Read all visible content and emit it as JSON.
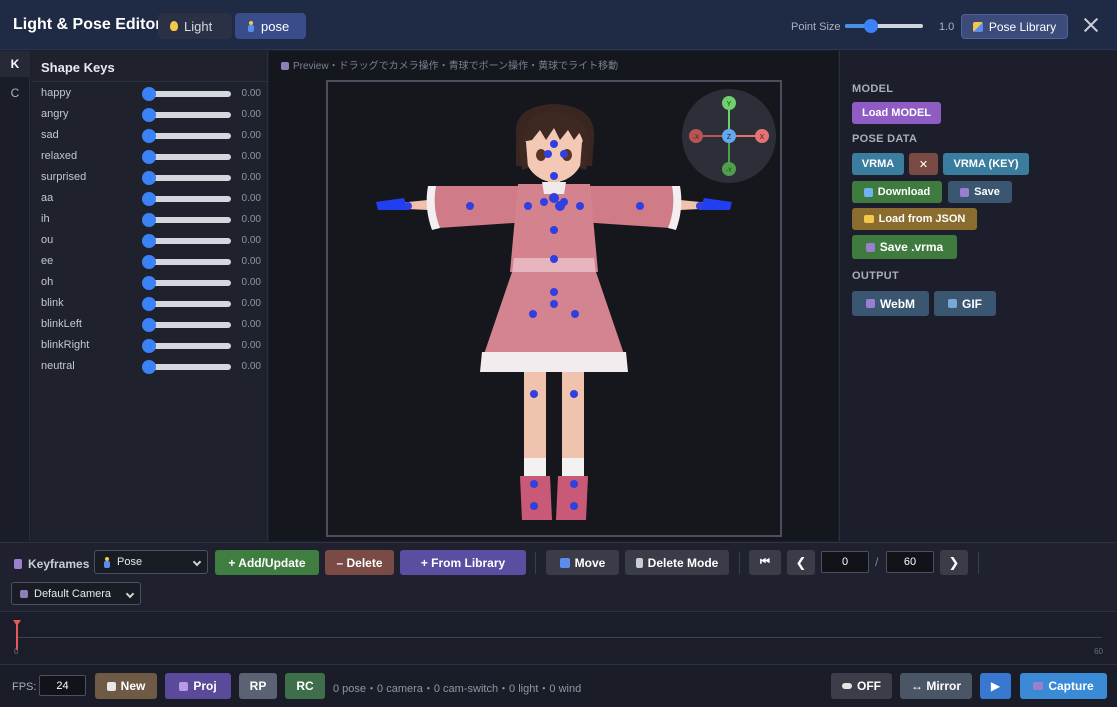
{
  "header": {
    "title": "Light & Pose Editor",
    "tabs": [
      {
        "label": "Light",
        "icon": "lightbulb-icon"
      },
      {
        "label": "pose",
        "icon": "figure-icon"
      }
    ],
    "point_size_label": "Point Size",
    "point_size_value": "1.0",
    "point_size_fraction": 0.33,
    "pose_library_label": "Pose Library"
  },
  "side_tabs": [
    "K",
    "C"
  ],
  "shape_keys": {
    "title": "Shape Keys",
    "items": [
      {
        "label": "happy",
        "value": "0.00"
      },
      {
        "label": "angry",
        "value": "0.00"
      },
      {
        "label": "sad",
        "value": "0.00"
      },
      {
        "label": "relaxed",
        "value": "0.00"
      },
      {
        "label": "surprised",
        "value": "0.00"
      },
      {
        "label": "aa",
        "value": "0.00"
      },
      {
        "label": "ih",
        "value": "0.00"
      },
      {
        "label": "ou",
        "value": "0.00"
      },
      {
        "label": "ee",
        "value": "0.00"
      },
      {
        "label": "oh",
        "value": "0.00"
      },
      {
        "label": "blink",
        "value": "0.00"
      },
      {
        "label": "blinkLeft",
        "value": "0.00"
      },
      {
        "label": "blinkRight",
        "value": "0.00"
      },
      {
        "label": "neutral",
        "value": "0.00"
      }
    ]
  },
  "preview": {
    "hint": "Preview・ドラッグでカメラ操作・青球でボーン操作・黄球でライト移動",
    "gizmo": {
      "x": "X",
      "neg_x": "-X",
      "y": "Y",
      "neg_y": "-Y",
      "z": "Z"
    }
  },
  "right_panel": {
    "model_heading": "MODEL",
    "load_model": "Load MODEL",
    "pose_heading": "POSE DATA",
    "vrma": "VRMA",
    "remove": "✕",
    "vrma_key": "VRMA (KEY)",
    "download": "Download",
    "save": "Save",
    "load_json": "Load from JSON",
    "save_vrma": "Save .vrma",
    "output_heading": "OUTPUT",
    "webm": "WebM",
    "gif": "GIF"
  },
  "keyframes": {
    "label": "Keyframes",
    "type_select": "Pose",
    "add_update": "+ Add/Update",
    "delete": "– Delete",
    "from_library": "+ From Library",
    "move": "Move",
    "delete_mode": "Delete Mode",
    "frame_current": "0",
    "frame_separator": "/",
    "frame_total": "60",
    "camera_select": "Default Camera"
  },
  "timeline": {
    "start": "0",
    "end": "60"
  },
  "footer": {
    "fps_label": "FPS:",
    "fps_value": "24",
    "new": "New",
    "proj": "Proj",
    "rp": "RP",
    "rc": "RC",
    "status": "0 pose・0 camera・0 cam-switch・0 light・0 wind",
    "off": "OFF",
    "mirror": "↔ Mirror",
    "play": "▶",
    "capture": "Capture"
  },
  "colors": {
    "accent": "#3b82f6",
    "joint": "#2f3fe0",
    "dress": "#d88a95"
  }
}
